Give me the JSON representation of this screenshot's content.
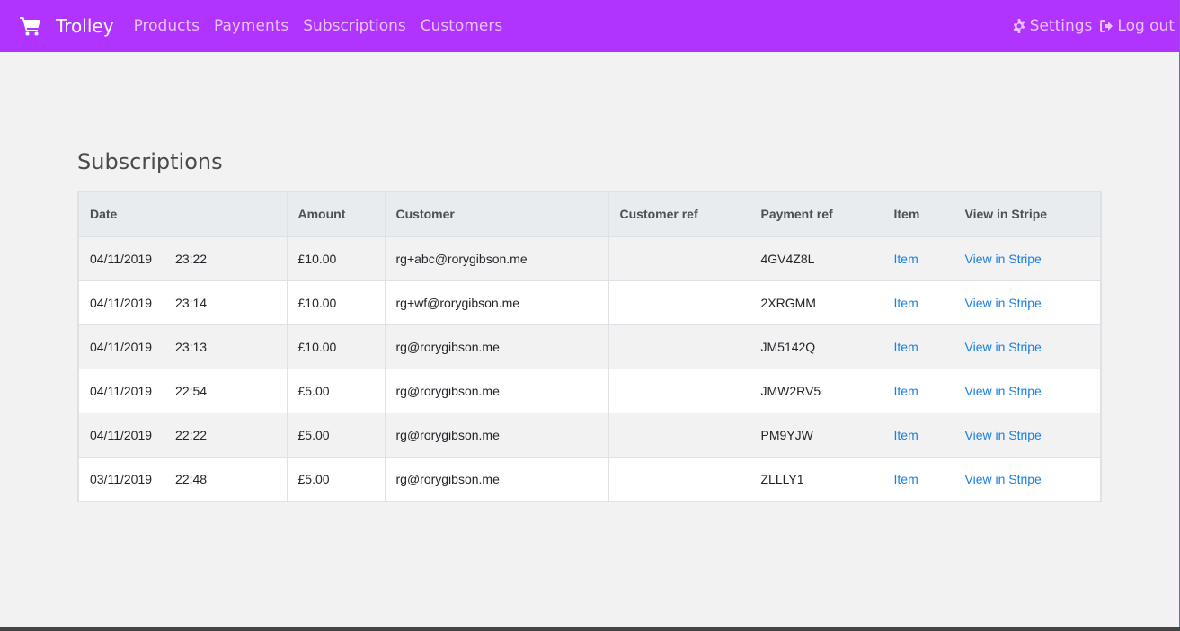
{
  "nav": {
    "brand": "Trolley",
    "brand_icon": "shopping-cart-icon",
    "links": [
      {
        "label": "Products"
      },
      {
        "label": "Payments"
      },
      {
        "label": "Subscriptions"
      },
      {
        "label": "Customers"
      }
    ],
    "settings": {
      "label": "Settings",
      "icon": "gear-icon"
    },
    "logout": {
      "label": "Log out",
      "icon": "sign-out-icon"
    },
    "colors": {
      "bar": "#b133fe",
      "link": "#e7c2ff"
    }
  },
  "page": {
    "title": "Subscriptions"
  },
  "table": {
    "headers": [
      "Date",
      "Amount",
      "Customer",
      "Customer ref",
      "Payment ref",
      "Item",
      "View in Stripe"
    ],
    "rows": [
      {
        "date": "04/11/2019",
        "time": "23:22",
        "amount": "£10.00",
        "customer": "rg+abc@rorygibson.me",
        "customer_ref": "",
        "payment_ref": "4GV4Z8L",
        "item": "Item",
        "stripe": "View in Stripe"
      },
      {
        "date": "04/11/2019",
        "time": "23:14",
        "amount": "£10.00",
        "customer": "rg+wf@rorygibson.me",
        "customer_ref": "",
        "payment_ref": "2XRGMM",
        "item": "Item",
        "stripe": "View in Stripe"
      },
      {
        "date": "04/11/2019",
        "time": "23:13",
        "amount": "£10.00",
        "customer": "rg@rorygibson.me",
        "customer_ref": "",
        "payment_ref": "JM5142Q",
        "item": "Item",
        "stripe": "View in Stripe"
      },
      {
        "date": "04/11/2019",
        "time": "22:54",
        "amount": "£5.00",
        "customer": "rg@rorygibson.me",
        "customer_ref": "",
        "payment_ref": "JMW2RV5",
        "item": "Item",
        "stripe": "View in Stripe"
      },
      {
        "date": "04/11/2019",
        "time": "22:22",
        "amount": "£5.00",
        "customer": "rg@rorygibson.me",
        "customer_ref": "",
        "payment_ref": "PM9YJW",
        "item": "Item",
        "stripe": "View in Stripe"
      },
      {
        "date": "03/11/2019",
        "time": "22:48",
        "amount": "£5.00",
        "customer": "rg@rorygibson.me",
        "customer_ref": "",
        "payment_ref": "ZLLLY1",
        "item": "Item",
        "stripe": "View in Stripe"
      }
    ],
    "link_color": "#1a7fe0"
  }
}
